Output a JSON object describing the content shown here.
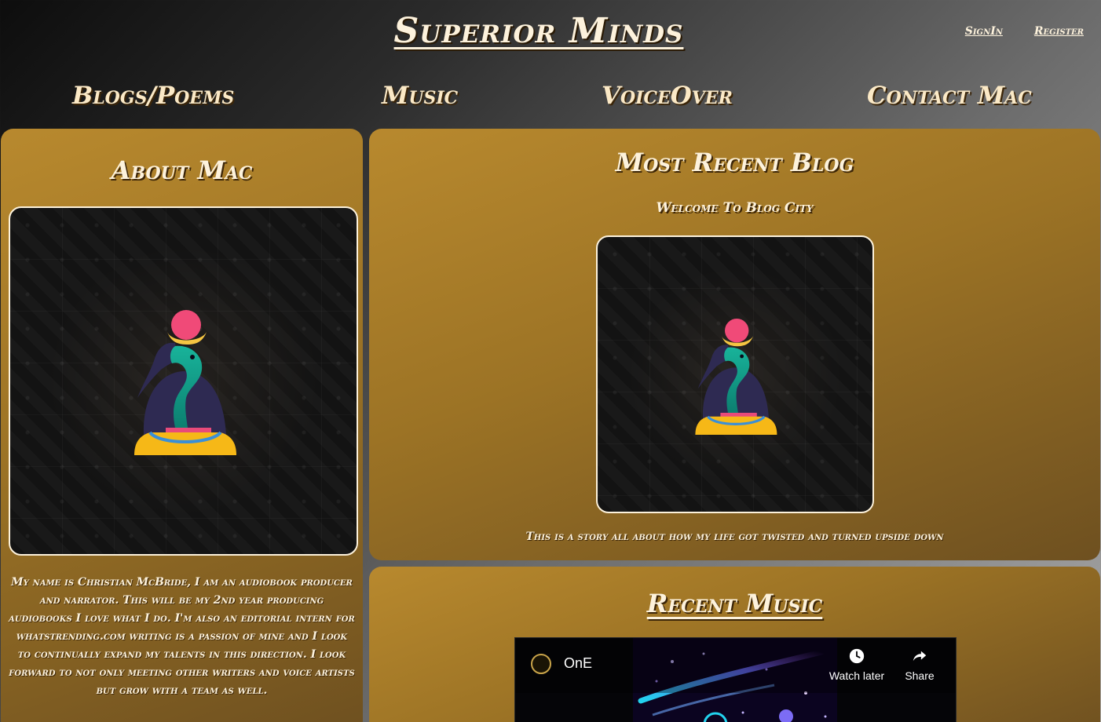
{
  "header": {
    "site_title": "Superior Minds",
    "signin_label": "SignIn",
    "register_label": "Register"
  },
  "nav": {
    "blogs_label": "Blogs/Poems",
    "music_label": "Music",
    "voiceover_label": "VoiceOver",
    "contact_label": "Contact Mac"
  },
  "about": {
    "heading": "About Mac",
    "image_icon": "thoth-icon",
    "bio": "My name is Christian McBride, I am an audiobook producer and narrator. This will be my 2nd year producing audiobooks I love what I do. I'm also an editorial intern for whatstrending.com writing is a passion of mine and I look to continually expand my talents in this direction. I look forward to not only meeting other writers and voice artists but grow with a team as well."
  },
  "recent_blog": {
    "heading": "Most Recent Blog",
    "post_title": "Welcome To Blog City",
    "image_icon": "thoth-icon",
    "excerpt": "This is a story all about how my life got twisted and turned upside down"
  },
  "recent_music": {
    "heading": "Recent Music",
    "video": {
      "title": "OnE",
      "watch_later_label": "Watch later",
      "share_label": "Share"
    }
  },
  "colors": {
    "panel_gold": "#b8892e",
    "text_cream": "#fdf2dc"
  }
}
